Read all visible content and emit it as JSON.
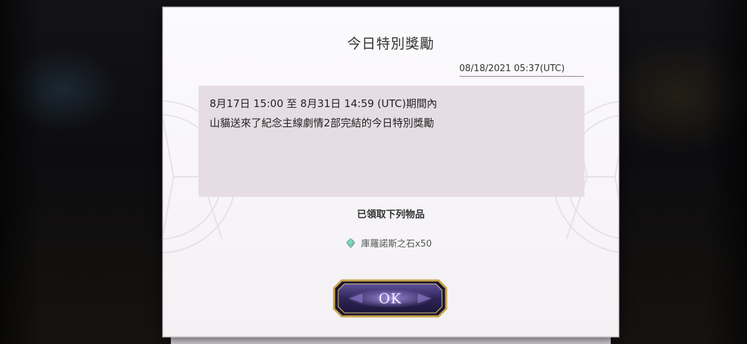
{
  "dialog": {
    "title": "今日特別獎勵",
    "timestamp": "08/18/2021 05:37(UTC)",
    "message_lines": [
      "8月17日 15:00 至 8月31日 14:59 (UTC)期間內",
      "山貓送來了紀念主線劇情2部完結的今日特別獎勵"
    ],
    "received_label": "已領取下列物品",
    "rewards": [
      {
        "icon": "chronos-stone-icon",
        "label": "庫羅諾斯之石x50"
      }
    ],
    "ok_label": "OK"
  },
  "colors": {
    "dialog_bg": "#f8f6f9",
    "message_bg": "#e6dde3",
    "button_purple": "#3b2f6e",
    "button_gold": "#c9a54a"
  }
}
